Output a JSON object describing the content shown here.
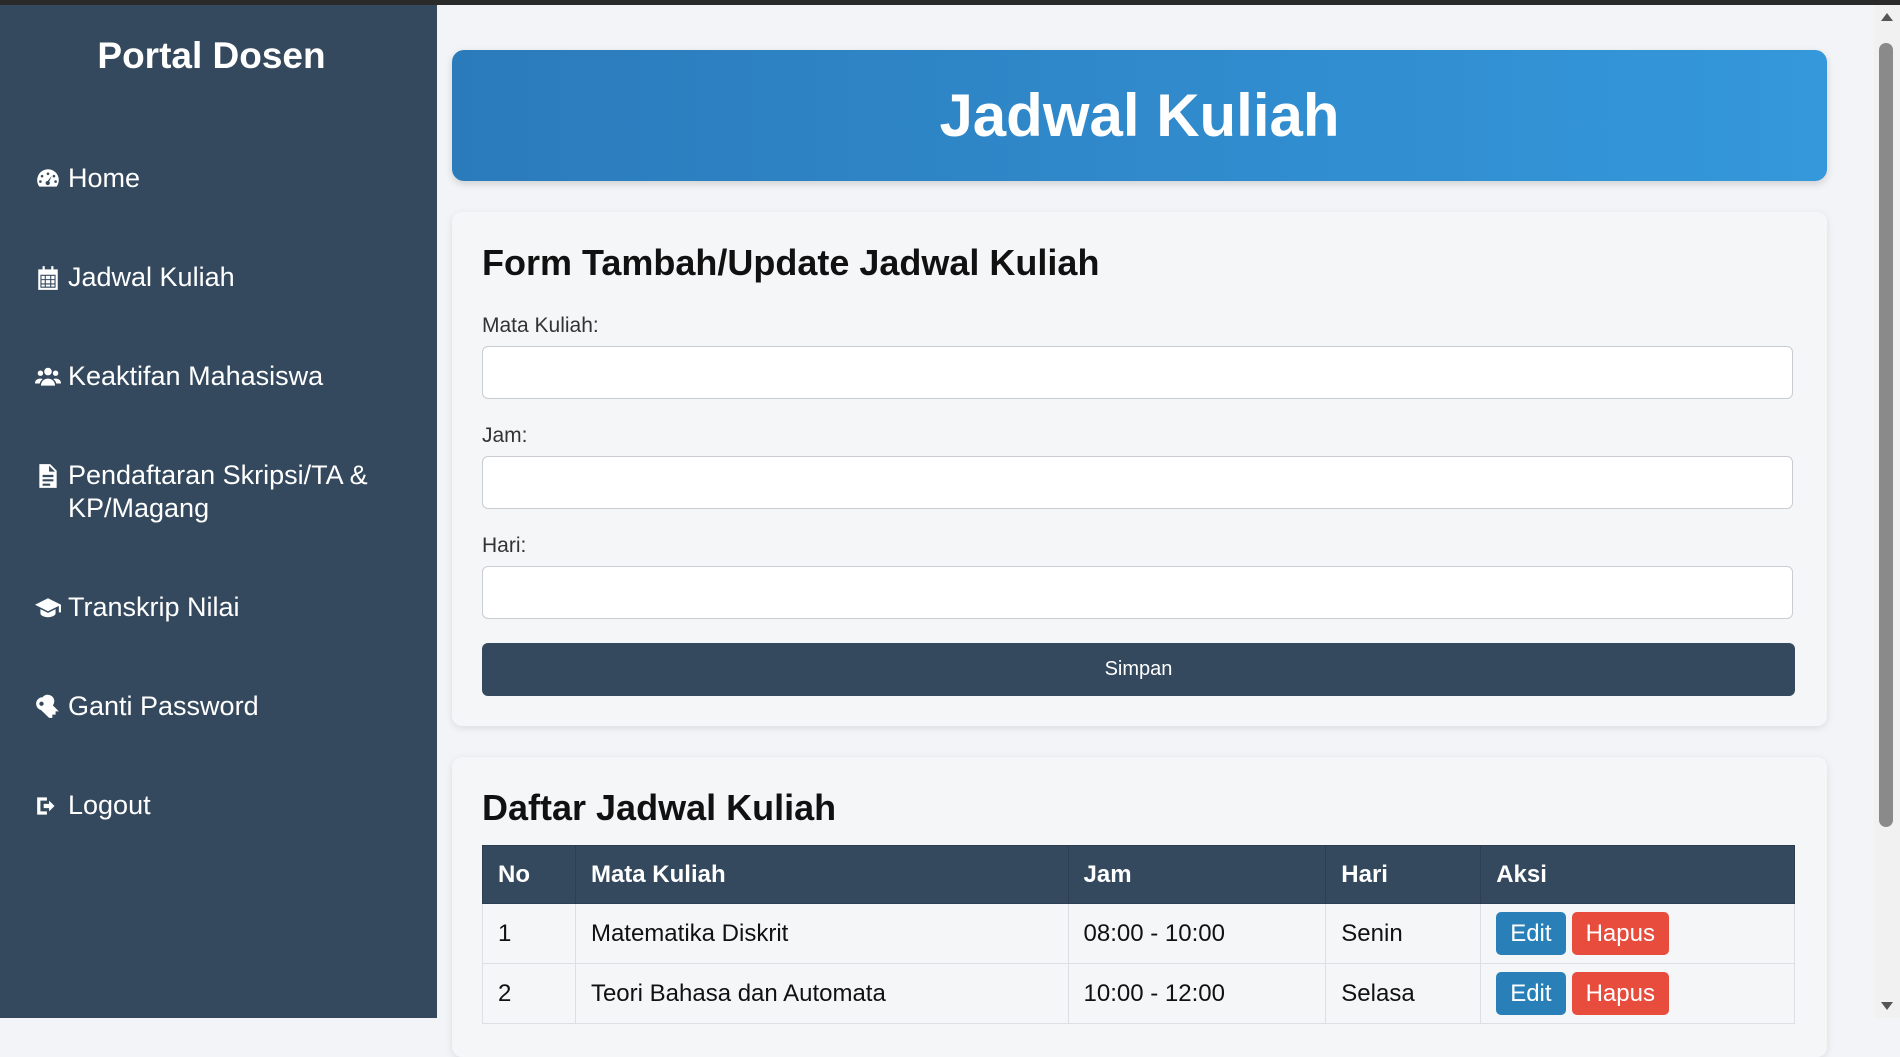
{
  "sidebar": {
    "title": "Portal Dosen",
    "items": [
      {
        "label": "Home",
        "icon": "dashboard-icon"
      },
      {
        "label": "Jadwal Kuliah",
        "icon": "calendar-icon"
      },
      {
        "label": "Keaktifan Mahasiswa",
        "icon": "users-icon"
      },
      {
        "label": "Pendaftaran Skripsi/TA & KP/Magang",
        "icon": "file-icon"
      },
      {
        "label": "Transkrip Nilai",
        "icon": "graduation-cap-icon"
      },
      {
        "label": "Ganti Password",
        "icon": "key-icon"
      },
      {
        "label": "Logout",
        "icon": "logout-icon"
      }
    ]
  },
  "header": {
    "title": "Jadwal Kuliah"
  },
  "form": {
    "title": "Form Tambah/Update Jadwal Kuliah",
    "fields": [
      {
        "label": "Mata Kuliah:",
        "value": ""
      },
      {
        "label": "Jam:",
        "value": ""
      },
      {
        "label": "Hari:",
        "value": ""
      }
    ],
    "submit_label": "Simpan"
  },
  "list": {
    "title": "Daftar Jadwal Kuliah",
    "columns": [
      "No",
      "Mata Kuliah",
      "Jam",
      "Hari",
      "Aksi"
    ],
    "rows": [
      {
        "no": "1",
        "mata_kuliah": "Matematika Diskrit",
        "jam": "08:00 - 10:00",
        "hari": "Senin"
      },
      {
        "no": "2",
        "mata_kuliah": "Teori Bahasa dan Automata",
        "jam": "10:00 - 12:00",
        "hari": "Selasa"
      }
    ],
    "edit_label": "Edit",
    "delete_label": "Hapus"
  },
  "colors": {
    "sidebar_bg": "#34495e",
    "banner_start": "#2b7bbb",
    "banner_end": "#3498db",
    "edit_button": "#2980b9",
    "delete_button": "#e74c3c"
  }
}
